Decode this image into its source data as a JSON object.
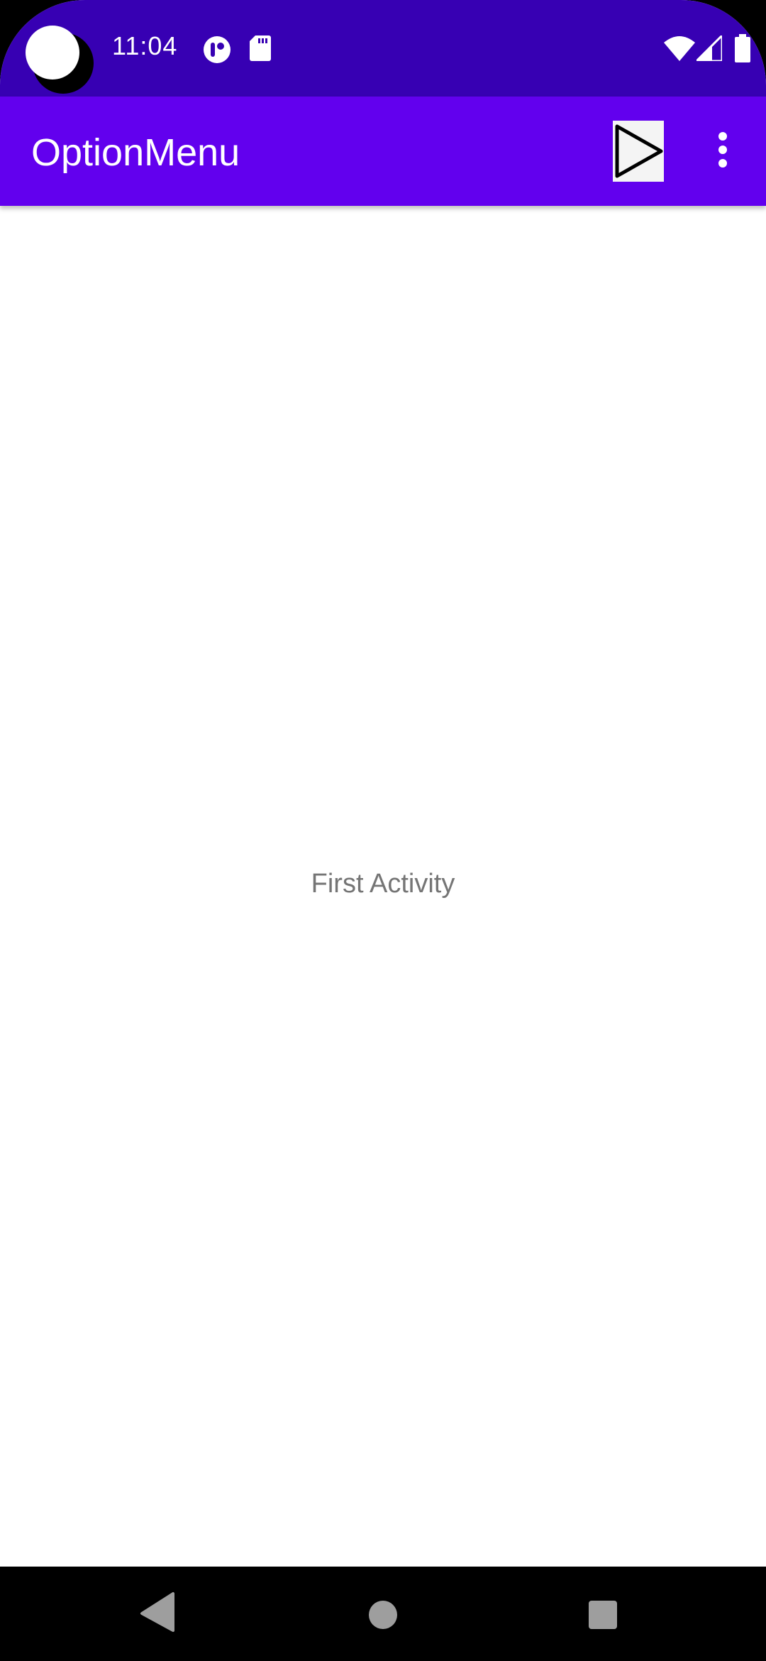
{
  "status_bar": {
    "time": "11:04",
    "left_icons": [
      "app-notification-icon",
      "sd-card-icon"
    ],
    "right_icons": [
      "wifi-icon",
      "cellular-signal-icon",
      "battery-icon"
    ],
    "background_color": "#3700b3"
  },
  "app_bar": {
    "title": "OptionMenu",
    "background_color": "#6200ee",
    "actions": [
      "play-icon",
      "overflow-menu-icon"
    ]
  },
  "main": {
    "text": "First Activity"
  },
  "nav_bar": {
    "buttons": [
      "back-icon",
      "home-icon",
      "recents-icon"
    ]
  }
}
